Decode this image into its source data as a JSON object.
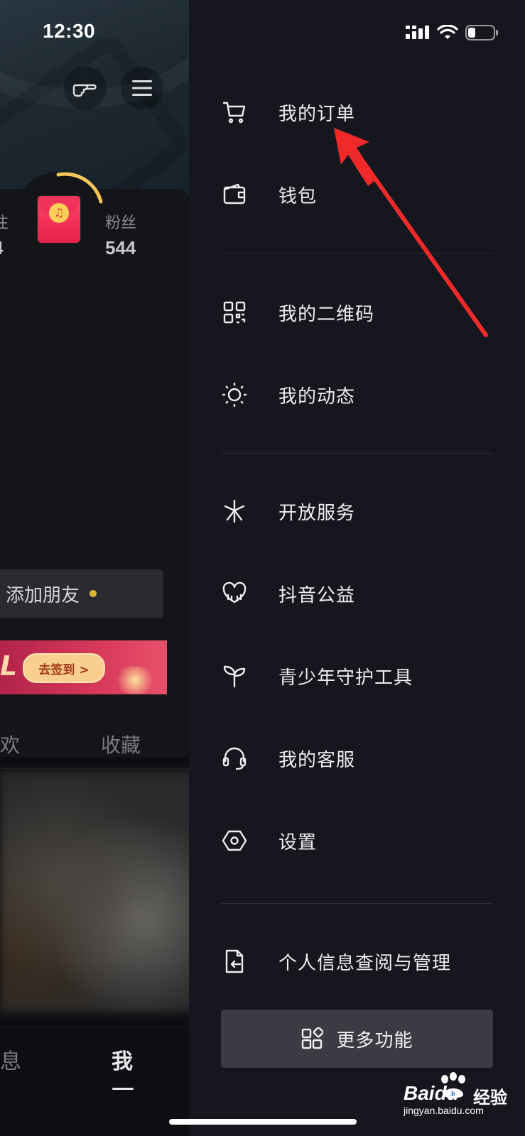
{
  "status_bar": {
    "time": "12:30"
  },
  "left_page": {
    "stats": [
      {
        "label": "注",
        "value": "4"
      },
      {
        "label": "粉丝",
        "value": "544"
      }
    ],
    "add_friend": "添加朋友",
    "signin": {
      "badge_text": "L",
      "button": "去签到 >"
    },
    "tabs": {
      "partial": "欢",
      "favorites": "收藏"
    },
    "bottom_nav": {
      "partial": "息",
      "me": "我"
    }
  },
  "drawer": {
    "items": [
      {
        "icon": "cart-icon",
        "label": "我的订单"
      },
      {
        "icon": "wallet-icon",
        "label": "钱包"
      },
      {
        "icon": "qrcode-icon",
        "label": "我的二维码"
      },
      {
        "icon": "sun-icon",
        "label": "我的动态"
      },
      {
        "icon": "open-service-icon",
        "label": "开放服务"
      },
      {
        "icon": "charity-heart-icon",
        "label": "抖音公益"
      },
      {
        "icon": "sprout-icon",
        "label": "青少年守护工具"
      },
      {
        "icon": "headset-icon",
        "label": "我的客服"
      },
      {
        "icon": "hexagon-settings-icon",
        "label": "设置"
      },
      {
        "icon": "document-return-icon",
        "label": "个人信息查阅与管理"
      }
    ],
    "more_button": "更多功能"
  },
  "watermark": {
    "brand": "Baidu",
    "cn": "经验",
    "url": "jingyan.baidu.com"
  },
  "colors": {
    "drawer_bg": "#16171e",
    "accent_arrow": "#f02a2a",
    "text": "#eeeef0"
  }
}
